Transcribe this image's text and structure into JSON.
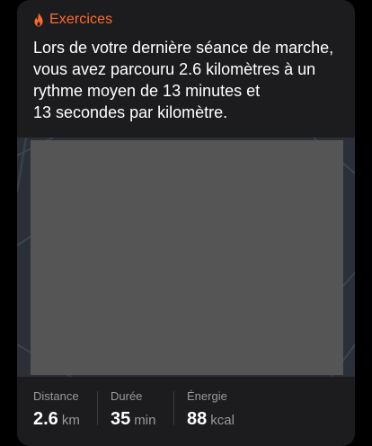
{
  "header": {
    "title": "Exercices",
    "icon": "flame-icon",
    "accent_color": "#ff6a2a"
  },
  "summary": {
    "line1": "Lors de votre dernière séance de marche,",
    "line2": "vous avez parcouru 2.6 kilomètres à un",
    "line3": "rythme moyen de 13 minutes et",
    "line4": "13 secondes par kilomètre."
  },
  "stats": [
    {
      "label": "Distance",
      "value": "2.6",
      "unit": "km"
    },
    {
      "label": "Durée",
      "value": "35",
      "unit": "min"
    },
    {
      "label": "Énergie",
      "value": "88",
      "unit": "kcal"
    }
  ]
}
